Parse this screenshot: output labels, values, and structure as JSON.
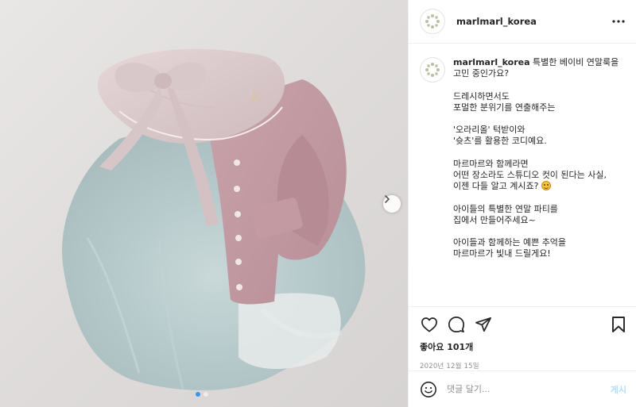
{
  "post": {
    "username": "marlmarl_korea",
    "caption_user": "marlmarl_korea",
    "caption_first": "특별한 베이비 연말룩을 고민 중인가요?",
    "caption_lines": [
      "드레시하면서도",
      "포멀한 분위기를 연출해주는",
      "",
      "'오라리올' 턱받이와",
      "'슛츠'를 활용한 코디예요.",
      "",
      "마르마르와 함께라면",
      "어떤 장소라도 스튜디오 컷이 된다는 사실,",
      "이젠 다들 알고 계시죠?",
      "",
      "아이들의 특별한 연말 파티를",
      "집에서 만들어주세요~",
      "",
      "아이들과 함께하는 예쁜 추억을",
      "마르마르가 빛내 드릴게요!"
    ],
    "likes": "좋아요 101개",
    "date": "2020년 12월 15일"
  },
  "comment": {
    "placeholder": "댓글 달기...",
    "post_label": "게시"
  },
  "carousel": {
    "count": 2,
    "active_index": 0
  },
  "icons": {
    "header_more": "more-horizontal-icon",
    "like": "heart-icon",
    "comment": "comment-bubble-icon",
    "share": "paper-plane-icon",
    "save": "bookmark-icon",
    "emoji": "smiley-icon",
    "next": "chevron-right-icon"
  },
  "colors": {
    "accent": "#3897f0",
    "post_button_disabled": "#b2dffc",
    "secondary_text": "#8e8e8e",
    "border": "#efefef"
  }
}
